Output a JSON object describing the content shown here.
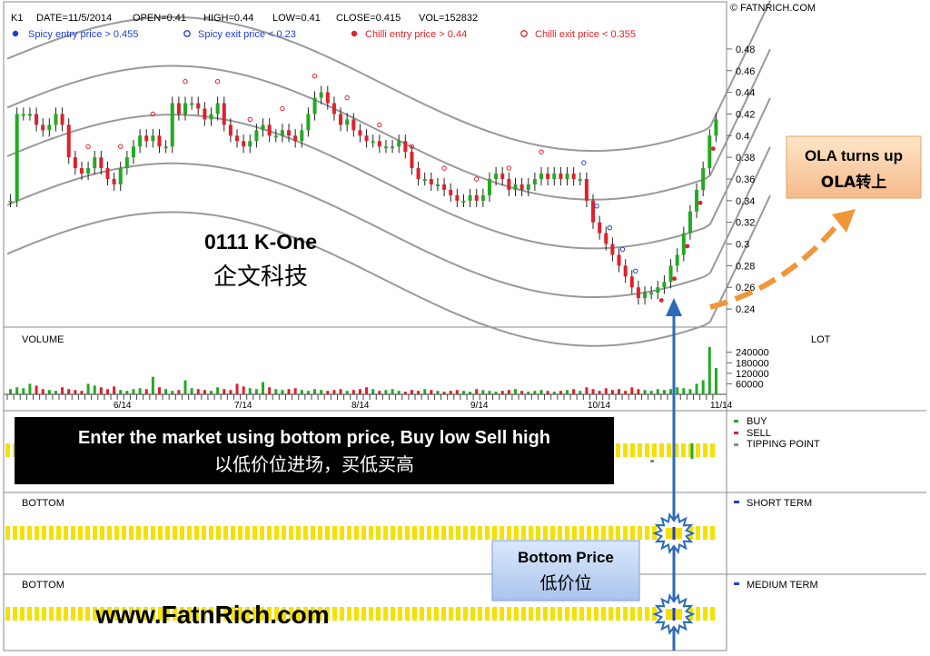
{
  "header": {
    "symbol": "K1",
    "date": "DATE=11/5/2014",
    "open": "OPEN=0.41",
    "high": "HIGH=0.44",
    "low": "LOW=0.41",
    "close": "CLOSE=0.415",
    "vol": "VOL=152832",
    "copyright": "© FATNRICH.COM"
  },
  "legend": [
    {
      "label": "Spicy entry price > 0.455",
      "color": "#1a3fd6",
      "filled": true
    },
    {
      "label": "Spicy exit price < 0.23",
      "color": "#1a3fd6",
      "filled": false
    },
    {
      "label": "Chilli entry price > 0.44",
      "color": "#e0202a",
      "filled": true
    },
    {
      "label": "Chilli exit price < 0.355",
      "color": "#e0202a",
      "filled": false
    }
  ],
  "stock": {
    "code": "0111 K-One",
    "chinese": "企文科技"
  },
  "callout_ola": {
    "line1": "OLA turns up",
    "line2": "OLA转上"
  },
  "banner": {
    "line1": "Enter the market using bottom price, Buy low Sell high",
    "line2": "以低价位进场，买低买高"
  },
  "bottom_price_box": {
    "line1": "Bottom Price",
    "line2": "低价位"
  },
  "website": "www.FatnRich.com",
  "volume_panel": {
    "label": "VOLUME",
    "unit": "LOT",
    "ticks": [
      "240000",
      "180000",
      "120000",
      "60000"
    ]
  },
  "months": [
    "6/14",
    "7/14",
    "8/14",
    "9/14",
    "10/14",
    "11/14"
  ],
  "signal_panel": {
    "legend": [
      {
        "label": "BUY",
        "color": "#22aa22"
      },
      {
        "label": "SELL",
        "color": "#e0202a"
      },
      {
        "label": "TIPPING POINT",
        "color": "#888888"
      }
    ]
  },
  "bottom_short": {
    "label": "BOTTOM",
    "legend": "SHORT TERM",
    "color": "#1a3fd6"
  },
  "bottom_medium": {
    "label": "BOTTOM",
    "legend": "MEDIUM TERM",
    "color": "#1a3fd6"
  },
  "chart_data": {
    "type": "candlestick",
    "title": "0111 K-One",
    "y_ticks": [
      "0.48",
      "0.46",
      "0.44",
      "0.42",
      "0.4",
      "0.38",
      "0.36",
      "0.34",
      "0.32",
      "0.3",
      "0.28",
      "0.26",
      "0.24"
    ],
    "ylim": [
      0.23,
      0.49
    ],
    "x_range": [
      "2014-05",
      "2014-11-05"
    ],
    "closes_approx": [
      0.34,
      0.42,
      0.42,
      0.42,
      0.41,
      0.405,
      0.41,
      0.42,
      0.41,
      0.38,
      0.37,
      0.365,
      0.37,
      0.38,
      0.37,
      0.36,
      0.355,
      0.37,
      0.38,
      0.39,
      0.4,
      0.395,
      0.4,
      0.39,
      0.39,
      0.43,
      0.42,
      0.43,
      0.43,
      0.425,
      0.415,
      0.42,
      0.43,
      0.41,
      0.4,
      0.395,
      0.39,
      0.395,
      0.405,
      0.41,
      0.4,
      0.4,
      0.405,
      0.4,
      0.395,
      0.405,
      0.42,
      0.435,
      0.44,
      0.43,
      0.42,
      0.41,
      0.415,
      0.405,
      0.4,
      0.395,
      0.395,
      0.39,
      0.39,
      0.39,
      0.395,
      0.385,
      0.37,
      0.36,
      0.36,
      0.355,
      0.355,
      0.35,
      0.345,
      0.34,
      0.34,
      0.345,
      0.34,
      0.345,
      0.36,
      0.365,
      0.36,
      0.35,
      0.355,
      0.35,
      0.355,
      0.36,
      0.365,
      0.36,
      0.365,
      0.36,
      0.365,
      0.36,
      0.36,
      0.34,
      0.32,
      0.31,
      0.3,
      0.29,
      0.28,
      0.27,
      0.26,
      0.25,
      0.255,
      0.255,
      0.26,
      0.265,
      0.28,
      0.29,
      0.31,
      0.33,
      0.35,
      0.37,
      0.4,
      0.415
    ],
    "ola_bands_note": "five parallel sine-like OLA bands",
    "volume_approx": [
      30000,
      40000,
      35000,
      60000,
      50000,
      30000,
      25000,
      20000,
      40000,
      30000,
      25000,
      20000,
      60000,
      50000,
      40000,
      30000,
      45000,
      25000,
      20000,
      30000,
      35000,
      30000,
      100000,
      40000,
      30000,
      20000,
      25000,
      80000,
      35000,
      30000,
      25000,
      20000,
      40000,
      30000,
      25000,
      60000,
      45000,
      35000,
      30000,
      70000,
      40000,
      30000,
      25000,
      30000,
      35000,
      25000,
      20000,
      30000,
      25000,
      20000,
      25000,
      30000,
      20000,
      25000,
      30000,
      40000,
      30000,
      20000,
      25000,
      30000,
      20000,
      15000,
      25000,
      20000,
      30000,
      25000,
      20000,
      15000,
      20000,
      25000,
      20000,
      15000,
      30000,
      25000,
      20000,
      15000,
      20000,
      25000,
      30000,
      20000,
      15000,
      20000,
      25000,
      20000,
      15000,
      20000,
      25000,
      30000,
      20000,
      40000,
      30000,
      20000,
      35000,
      25000,
      30000,
      20000,
      40000,
      30000,
      25000,
      20000,
      30000,
      25000,
      30000,
      40000,
      35000,
      30000,
      60000,
      80000,
      270000,
      150000
    ]
  }
}
